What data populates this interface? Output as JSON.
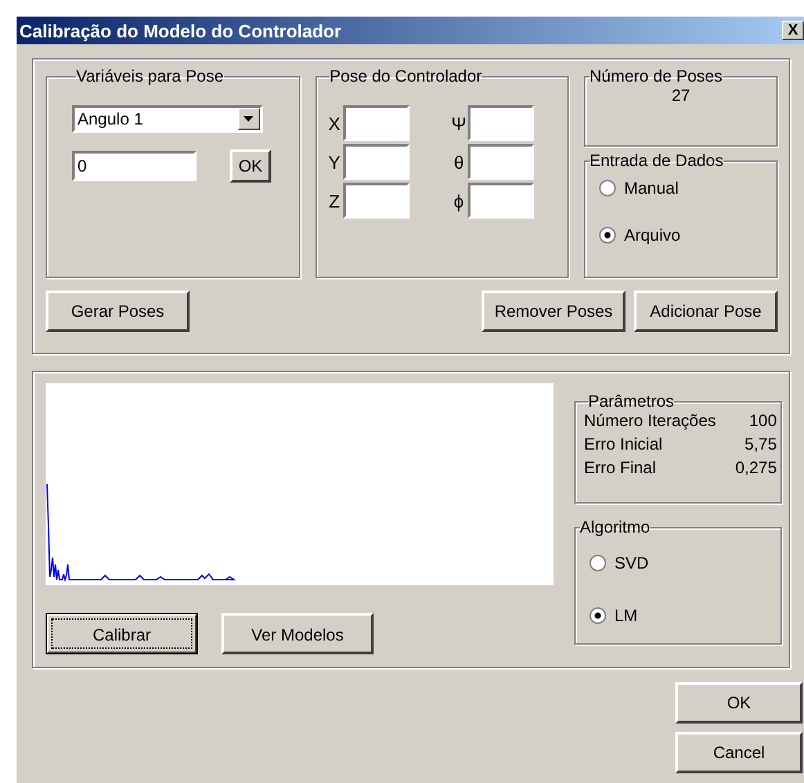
{
  "window": {
    "title": "Calibração do Modelo do Controlador",
    "close": "X"
  },
  "variables_group": {
    "title": "Variáveis para Pose",
    "dropdown": {
      "value": "Angulo 1"
    },
    "input": {
      "value": "0"
    },
    "button": "OK"
  },
  "pose_group": {
    "title": "Pose do Controlador",
    "fields": [
      {
        "label": "X"
      },
      {
        "label": "Ψ"
      },
      {
        "label": "Y"
      },
      {
        "label": "θ"
      },
      {
        "label": "Z"
      },
      {
        "label": "ϕ"
      }
    ]
  },
  "poses_count": {
    "title": "Número de Poses",
    "value": "27"
  },
  "data_input": {
    "title": "Entrada de Dados",
    "options": [
      {
        "label": "Manual",
        "selected": false
      },
      {
        "label": "Arquivo",
        "selected": true
      }
    ]
  },
  "actions": {
    "left": [
      "Gerar Poses"
    ],
    "right": [
      "Remover Poses",
      "Adicionar Pose"
    ]
  },
  "parameters": {
    "title": "Parâmetros",
    "rows": [
      {
        "label": "Número Iterações",
        "value": "100"
      },
      {
        "label": "Erro Inicial",
        "value": "5,75"
      },
      {
        "label": "Erro Final",
        "value": "0,275"
      }
    ]
  },
  "algorithm": {
    "title": "Algoritmo",
    "options": [
      {
        "label": "SVD",
        "selected": false
      },
      {
        "label": "LM",
        "selected": true
      }
    ]
  },
  "plot_buttons": [
    {
      "label": "Calibrar",
      "focused": true
    },
    {
      "label": "Ver Modelos",
      "focused": false
    }
  ],
  "dialog_buttons": [
    "OK",
    "Cancel"
  ]
}
